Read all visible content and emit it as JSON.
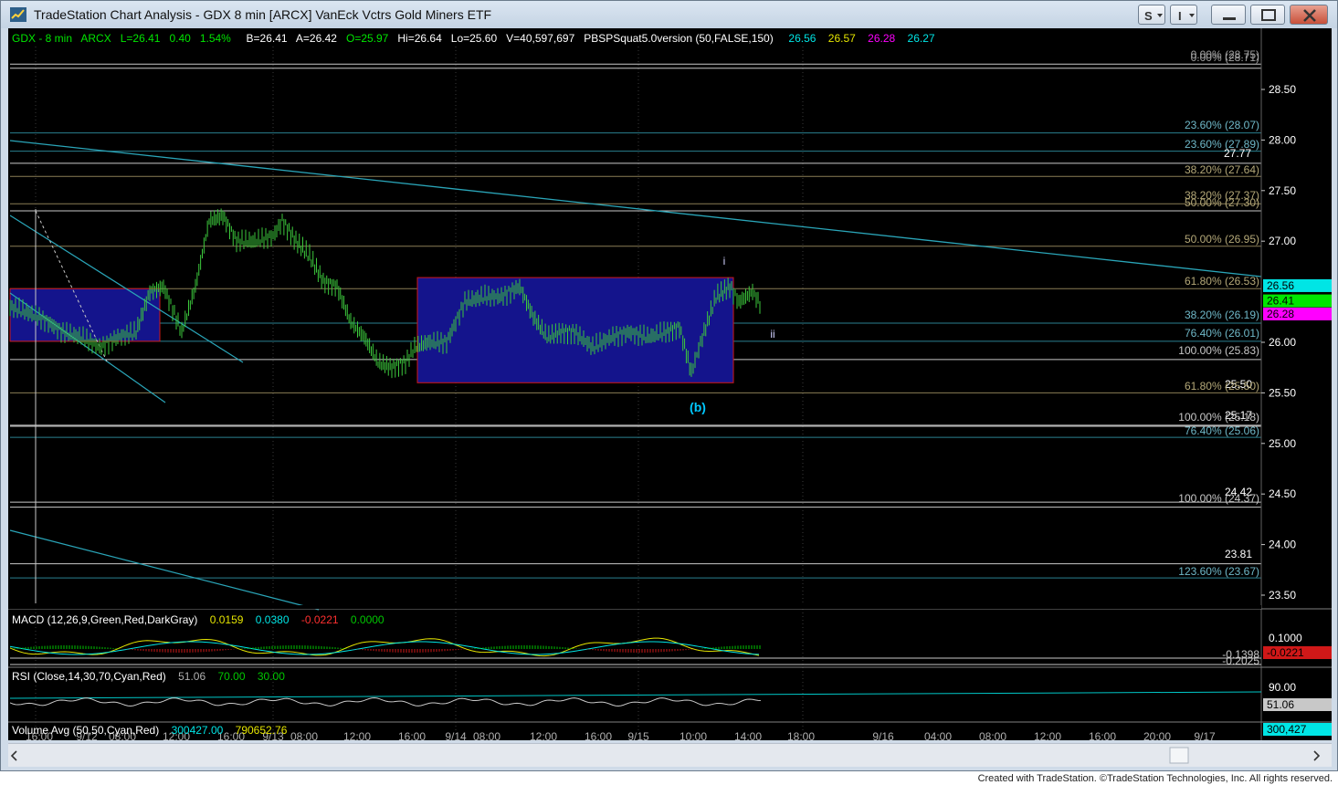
{
  "window": {
    "title": "TradeStation Chart Analysis - GDX 8 min [ARCX] VanEck Vctrs Gold Miners ETF",
    "buttons": [
      "S",
      "I",
      "minimize",
      "maximize",
      "close"
    ]
  },
  "legend": {
    "symbol": "GDX - 8 min",
    "exchange": "ARCX",
    "last": "L=26.41",
    "change": "0.40",
    "pct": "1.54%",
    "bid": "B=26.41",
    "ask": "A=26.42",
    "open": "O=25.97",
    "high": "Hi=26.64",
    "low": "Lo=25.60",
    "volume": "V=40,597,697",
    "study": "PBSPSquat5.0version (50,FALSE,150)",
    "study_values": [
      "26.56",
      "26.57",
      "26.28",
      "26.27"
    ]
  },
  "price_axis": {
    "ticks": [
      "28.50",
      "28.00",
      "27.50",
      "27.00",
      "26.00",
      "25.50",
      "25.00",
      "24.50",
      "24.00",
      "23.50"
    ],
    "markers": [
      {
        "label": "26.56",
        "color": "#00e5e5"
      },
      {
        "label": "26.41",
        "color": "#00e600"
      },
      {
        "label": "26.28",
        "color": "#ff00ff"
      }
    ]
  },
  "fib_labels": [
    {
      "text": "0.00% (28.75)",
      "color": "#a0a0a0"
    },
    {
      "text": "0.00% (28.71)",
      "color": "#a0a0a0"
    },
    {
      "text": "23.60% (28.07)",
      "color": "#6fb8c8"
    },
    {
      "text": "23.60% (27.89)",
      "color": "#6fb8c8"
    },
    {
      "text": "27.77",
      "color": "#ffffff"
    },
    {
      "text": "38.20% (27.64)",
      "color": "#b4a878"
    },
    {
      "text": "38.20% (27.37)",
      "color": "#b4a878"
    },
    {
      "text": "50.00% (27.30)",
      "color": "#b4a878"
    },
    {
      "text": "50.00% (26.95)",
      "color": "#b4a878"
    },
    {
      "text": "61.80% (26.53)",
      "color": "#b4a878"
    },
    {
      "text": "38.20% (26.19)",
      "color": "#6fb8c8"
    },
    {
      "text": "76.40% (26.01)",
      "color": "#6fb8c8"
    },
    {
      "text": "100.00% (25.83)",
      "color": "#c8c8c8"
    },
    {
      "text": "25.50",
      "color": "#ffffff"
    },
    {
      "text": "61.80% (25.50)",
      "color": "#b4a878"
    },
    {
      "text": "25.17",
      "color": "#ffffff"
    },
    {
      "text": "100.00% (25.18)",
      "color": "#c8c8c8"
    },
    {
      "text": "76.40% (25.06)",
      "color": "#6fb8c8"
    },
    {
      "text": "24.42",
      "color": "#ffffff"
    },
    {
      "text": "100.00% (24.37)",
      "color": "#c8c8c8"
    },
    {
      "text": "23.81",
      "color": "#ffffff"
    },
    {
      "text": "123.60% (23.67)",
      "color": "#6fb8c8"
    }
  ],
  "wave_labels": {
    "i": "i",
    "ii": "ii",
    "b": "(b)"
  },
  "macd": {
    "title": "MACD (12,26,9,Green,Red,DarkGray)",
    "values": [
      "0.0159",
      "0.0380",
      "-0.0221",
      "0.0000"
    ],
    "axis": [
      "0.1000",
      "-0.1398",
      "-0.2025"
    ],
    "marker": "-0.0221"
  },
  "rsi": {
    "title": "RSI (Close,14,30,70,Cyan,Red)",
    "values": [
      "51.06",
      "70.00",
      "30.00"
    ],
    "axis": [
      "90.00",
      "30.00"
    ],
    "marker": "51.06"
  },
  "volume": {
    "title": "Volume Avg (50,50,Cyan,Red)",
    "values": [
      "300427.00",
      "790652.76"
    ],
    "marker": "300,427"
  },
  "time_axis": [
    "16:00",
    "9/12",
    "08:00",
    "12:00",
    "16:00",
    "9/13",
    "08:00",
    "12:00",
    "16:00",
    "9/14",
    "08:00",
    "12:00",
    "16:00",
    "9/15",
    "10:00",
    "14:00",
    "18:00",
    "9/16",
    "04:00",
    "08:00",
    "12:00",
    "16:00",
    "20:00",
    "9/17"
  ],
  "footer": "Created with TradeStation. ©TradeStation Technologies, Inc. All rights reserved.",
  "colors": {
    "background": "#000000",
    "price_bars": "#3cc83c",
    "box_fill": "#14148c",
    "box_border": "#d01818",
    "trendline": "#2aa5b8"
  }
}
